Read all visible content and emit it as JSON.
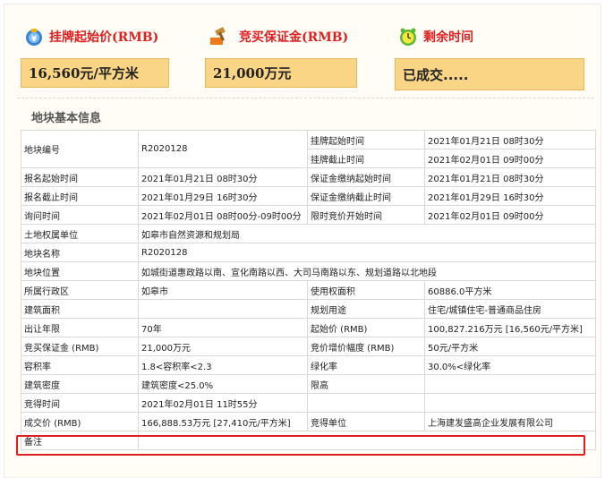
{
  "headers": {
    "start_price_label": "挂牌起始价(RMB)",
    "deposit_label": "竞买保证金(RMB)",
    "remaining_time_label": "剩余时间"
  },
  "values": {
    "start_price": "16,560元/平方米",
    "deposit": "21,000万元",
    "remaining_time": "已成交....."
  },
  "section_title": "地块基本信息",
  "table": {
    "r1": {
      "label": "地块编号",
      "value": "R2020128",
      "label2a": "挂牌起始时间",
      "value2a": "2021年01月21日 08时30分",
      "label2b": "挂牌截止时间",
      "value2b": "2021年02月01日 09时00分"
    },
    "r2": {
      "label": "报名起始时间",
      "value": "2021年01月21日 08时30分",
      "label2": "保证金缴纳起始时间",
      "value2": "2021年01月21日 08时30分"
    },
    "r3": {
      "label": "报名截止时间",
      "value": "2021年01月29日 16时30分",
      "label2": "保证金缴纳截止时间",
      "value2": "2021年01月29日 16时30分"
    },
    "r4": {
      "label": "询问时间",
      "value": "2021年02月01日 08时00分-09时00分",
      "label2": "限时竞价开始时间",
      "value2": "2021年02月01日 09时00分"
    },
    "r5": {
      "label": "土地权属单位",
      "value": "如皋市自然资源和规划局"
    },
    "r6": {
      "label": "地块名称",
      "value": "R2020128"
    },
    "r7": {
      "label": "地块位置",
      "value": "如城街道惠政路以南、宣化南路以西、大司马南路以东、规划道路以北地段"
    },
    "r8": {
      "label": "所属行政区",
      "value": "如皋市",
      "label2": "使用权面积",
      "value2": "60886.0平方米"
    },
    "r9": {
      "label": "建筑面积",
      "value": "",
      "label2": "规划用途",
      "value2": "住宅/城镇住宅-普通商品住房"
    },
    "r10": {
      "label": "出让年限",
      "value": "70年",
      "label2": "起始价 (RMB)",
      "value2": "100,827.216万元 [16,560元/平方米]"
    },
    "r11": {
      "label": "竞买保证金 (RMB)",
      "value": "21,000万元",
      "label2": "竞价增价幅度 (RMB)",
      "value2": "50元/平方米"
    },
    "r12": {
      "label": "容积率",
      "value": "1.8<容积率<2.3",
      "label2": "绿化率",
      "value2": "30.0%<绿化率"
    },
    "r13": {
      "label": "建筑密度",
      "value": "建筑密度<25.0%",
      "label2": "限高",
      "value2": ""
    },
    "r14": {
      "label": "竞得时间",
      "value": "2021年02月01日 11时55分"
    },
    "r15": {
      "label": "成交价 (RMB)",
      "value": "166,888.53万元 [27,410元/平方米]",
      "label2": "竞得单位",
      "value2": "上海建发盛高企业发展有限公司"
    },
    "r16": {
      "label": "备注",
      "value": ""
    }
  },
  "colors": {
    "accent_red": "#e02020",
    "highlight_box": "#fbd586",
    "highlight_border": "#e01e1e"
  },
  "icons": [
    "money-bag-icon",
    "auction-hammer-icon",
    "alarm-clock-icon"
  ]
}
